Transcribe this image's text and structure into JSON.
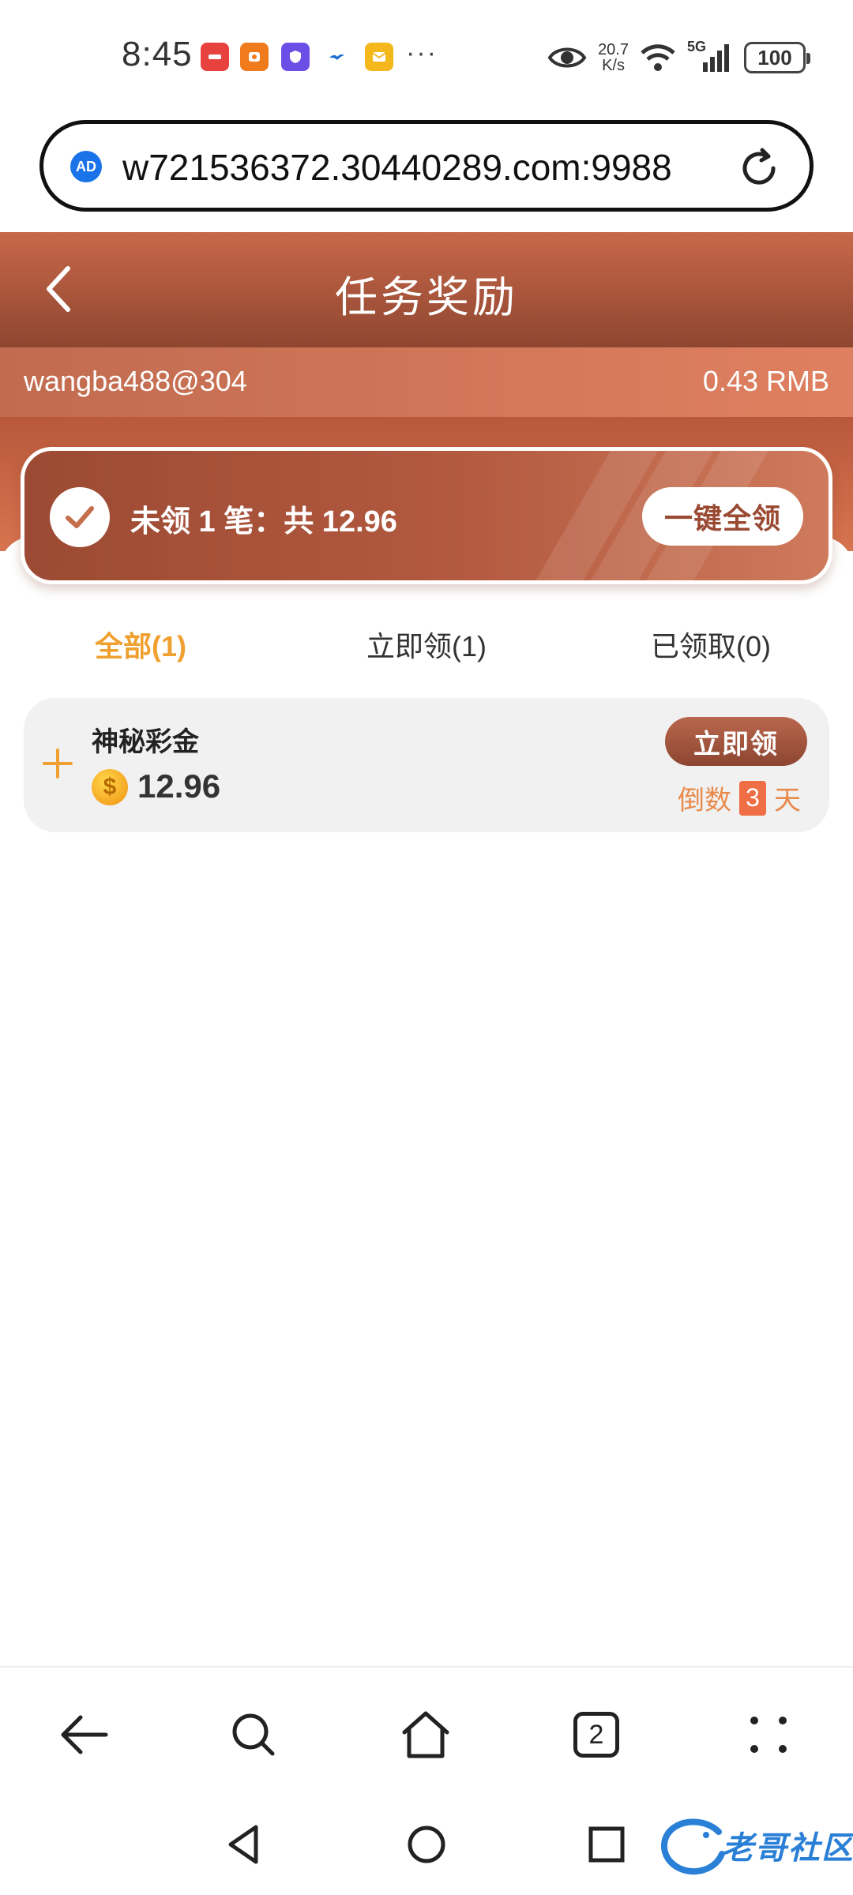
{
  "status_bar": {
    "time": "8:45",
    "more": "···",
    "speed_value": "20.7",
    "speed_unit": "K/s",
    "network": "5G",
    "battery": "100"
  },
  "url_bar": {
    "ad_badge": "AD",
    "url": "w721536372.30440289.com:9988"
  },
  "header": {
    "title": "任务奖励"
  },
  "account": {
    "username": "wangba488@304",
    "balance": "0.43 RMB"
  },
  "claim_card": {
    "summary": "未领 1 笔：共 12.96",
    "claim_all_label": "一键全领"
  },
  "tabs": [
    {
      "label": "全部(1)",
      "active": true
    },
    {
      "label": "立即领(1)",
      "active": false
    },
    {
      "label": "已领取(0)",
      "active": false
    }
  ],
  "rewards": [
    {
      "name": "神秘彩金",
      "amount": "12.96",
      "coin_symbol": "$",
      "claim_label": "立即领",
      "countdown_prefix": "倒数",
      "countdown_days": "3",
      "countdown_suffix": "天"
    }
  ],
  "browser_nav": {
    "tab_count": "2"
  },
  "watermark": {
    "text": "老哥社区"
  },
  "colors": {
    "brand": "#b35a40",
    "tab_active": "#f0a030",
    "countdown": "#e98a4a"
  },
  "icons": [
    "huawei-app-icon",
    "fox-app-icon",
    "shield-app-icon",
    "bird-app-icon",
    "mail-app-icon",
    "eye-icon",
    "wifi-icon",
    "signal-icon",
    "refresh-icon",
    "back-chevron-icon",
    "check-icon",
    "plus-icon",
    "coin-icon",
    "back-arrow-icon",
    "search-icon",
    "home-icon",
    "tabs-icon",
    "menu-dots-icon",
    "nav-back-triangle-icon",
    "nav-home-circle-icon",
    "nav-recents-square-icon"
  ]
}
